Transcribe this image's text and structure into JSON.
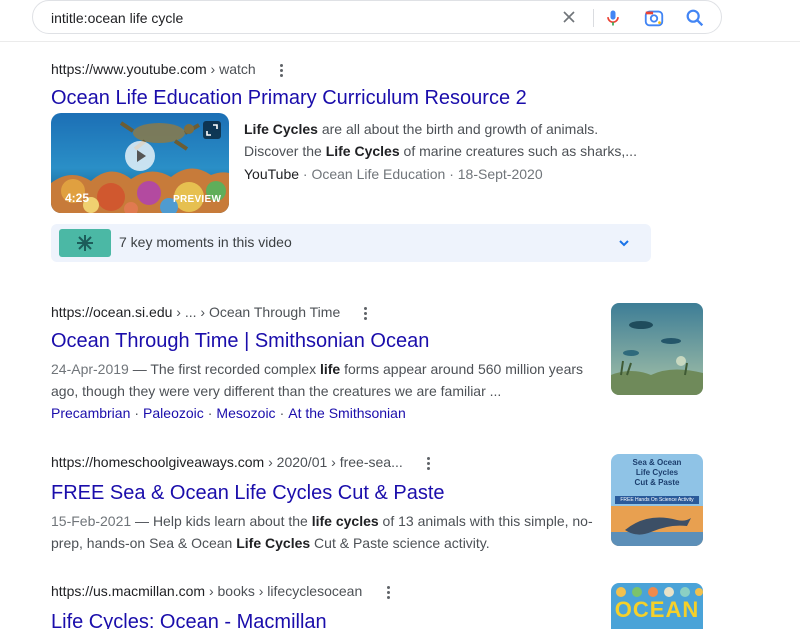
{
  "search": {
    "query": "intitle:ocean life cycle"
  },
  "results": [
    {
      "site": "https://www.youtube.com",
      "path": " › watch",
      "title": "Ocean Life Education Primary Curriculum Resource 2",
      "snippet": {
        "part1": "Life Cycles",
        "part2": " are all about the birth and growth of animals.",
        "part3": "Discover the ",
        "part4": "Life Cycles",
        "part5": " of marine creatures such as sharks,..."
      },
      "video": {
        "duration": "4:25",
        "preview_label": "PREVIEW",
        "platform": "YouTube",
        "channel": " · Ocean Life Education · 18-Sept-2020",
        "key_moments": "7 key moments in this video"
      }
    },
    {
      "site": "https://ocean.si.edu",
      "path": " › ... › Ocean Through Time",
      "title": "Ocean Through Time | Smithsonian Ocean",
      "snippet": {
        "date": "24-Apr-2019",
        "part1": " — The first recorded complex ",
        "part2": "life",
        "part3": " forms appear around 560 million years",
        "part4": "ago, though they were very different than the creatures we are familiar ..."
      },
      "sitelinks": [
        "Precambrian",
        "Paleozoic",
        "Mesozoic",
        "At the Smithsonian"
      ]
    },
    {
      "site": "https://homeschoolgiveaways.com",
      "path": " › 2020/01 › free-sea...",
      "title": "FREE Sea & Ocean Life Cycles Cut & Paste",
      "snippet": {
        "date": "15-Feb-2021",
        "part1": " — Help kids learn about the ",
        "part2": "life cycles",
        "part3": " of 13 animals with this simple, no-",
        "part4": "prep, hands-on Sea & Ocean ",
        "part5": "Life Cycles",
        "part6": " Cut & Paste science activity."
      },
      "thumb_text": {
        "line1": "Sea & Ocean",
        "line2": "Life Cycles",
        "line3": "Cut & Paste",
        "line4": "FREE Hands On Science Activity"
      }
    },
    {
      "site": "https://us.macmillan.com",
      "path": " › books › lifecyclesocean",
      "title": "Life Cycles: Ocean - Macmillan",
      "thumb_text": "OCEAN"
    }
  ],
  "colors": {
    "link": "#1a0dab",
    "text": "#202124",
    "muted": "#4d5156",
    "moments_bg": "#eef3fc",
    "search_icon": "#4285f4"
  }
}
